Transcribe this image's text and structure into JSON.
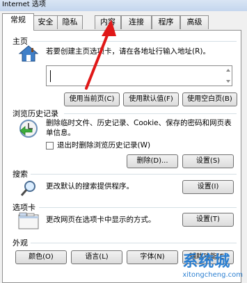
{
  "window": {
    "title": "Internet 选项"
  },
  "tabs": [
    {
      "label": "常规"
    },
    {
      "label": "安全"
    },
    {
      "label": "隐私"
    },
    {
      "label": "内容"
    },
    {
      "label": "连接"
    },
    {
      "label": "程序"
    },
    {
      "label": "高级"
    }
  ],
  "homepage": {
    "group_label": "主页",
    "description": "若要创建主页选项卡，请在各地址行输入地址(R)。",
    "url_value": "",
    "btn_current": "使用当前页(C)",
    "btn_default": "使用默认值(F)",
    "btn_blank": "使用空白页(B)"
  },
  "history": {
    "group_label": "浏览历史记录",
    "description": "删除临时文件、历史记录、Cookie、保存的密码和网页表单信息。",
    "checkbox_label": "退出时删除浏览历史记录(W)",
    "checkbox_checked": false,
    "btn_delete": "删除(D)...",
    "btn_settings": "设置(S)"
  },
  "search": {
    "group_label": "搜索",
    "description": "更改默认的搜索提供程序。",
    "btn_settings": "设置(I)"
  },
  "tabs_section": {
    "group_label": "选项卡",
    "description": "更改网页在选项卡中显示的方式。",
    "btn_settings": "设置(T)"
  },
  "appearance": {
    "group_label": "外观",
    "btn_colors": "颜色(O)",
    "btn_languages": "语言(L)",
    "btn_fonts": "字体(N)",
    "btn_accessibility": "辅助功能(E)"
  },
  "watermark": {
    "title": "系统城",
    "subtitle": "xitongcheng.com"
  },
  "colors": {
    "arrow": "#e01818",
    "watermark": "#2b7fd1",
    "panel_bg": "#ffffff"
  }
}
